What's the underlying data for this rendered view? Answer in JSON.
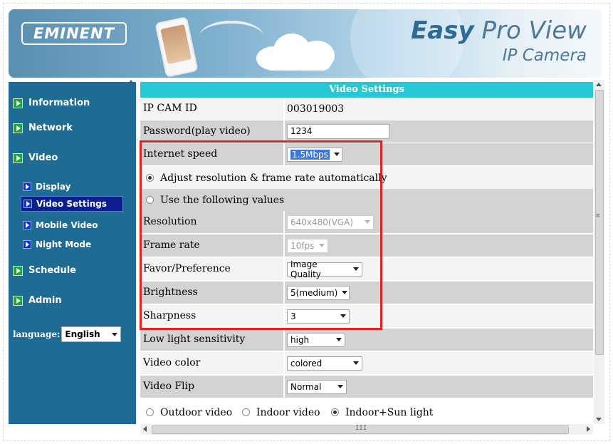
{
  "banner": {
    "logo_text": "EMINENT",
    "brand_title_bold": "Easy",
    "brand_title_rest": " Pro View",
    "brand_subtitle": "IP Camera"
  },
  "sidebar": {
    "items": [
      {
        "label": "Information"
      },
      {
        "label": "Network"
      },
      {
        "label": "Video"
      },
      {
        "label": "Schedule"
      },
      {
        "label": "Admin"
      }
    ],
    "video_sub": [
      {
        "label": "Display",
        "active": false
      },
      {
        "label": "Video Settings",
        "active": true
      },
      {
        "label": "Mobile Video",
        "active": false
      },
      {
        "label": "Night Mode",
        "active": false
      }
    ],
    "language_label": "language:",
    "language_value": "English"
  },
  "content": {
    "title": "Video Settings",
    "ip_cam_id_label": "IP CAM ID",
    "ip_cam_id_value": "003019003",
    "password_label": "Password(play video)",
    "password_value": "1234",
    "internet_speed_label": "Internet speed",
    "internet_speed_value": "1.5Mbps",
    "radio_auto_label": "Adjust resolution & frame rate automatically",
    "radio_manual_label": "Use the following values",
    "resolution_label": "Resolution",
    "resolution_value": "640x480(VGA)",
    "frame_rate_label": "Frame rate",
    "frame_rate_value": "10fps",
    "favor_label": "Favor/Preference",
    "favor_value": "Image Quality",
    "brightness_label": "Brightness",
    "brightness_value": "5(medium)",
    "sharpness_label": "Sharpness",
    "sharpness_value": "3",
    "low_light_label": "Low light sensitivity",
    "low_light_value": "high",
    "video_color_label": "Video color",
    "video_color_value": "colored",
    "video_flip_label": "Video Flip",
    "video_flip_value": "Normal",
    "env_outdoor": "Outdoor video",
    "env_indoor": "Indoor video",
    "env_indoor_sun": "Indoor+Sun light"
  },
  "scroll": {
    "grip": "III",
    "vgrip": "≡"
  },
  "colors": {
    "sidebar_bg": "#1e6b94",
    "title_bar": "#25c9d6",
    "active_nav": "#0b1f8e",
    "highlight_box": "#e02222"
  }
}
